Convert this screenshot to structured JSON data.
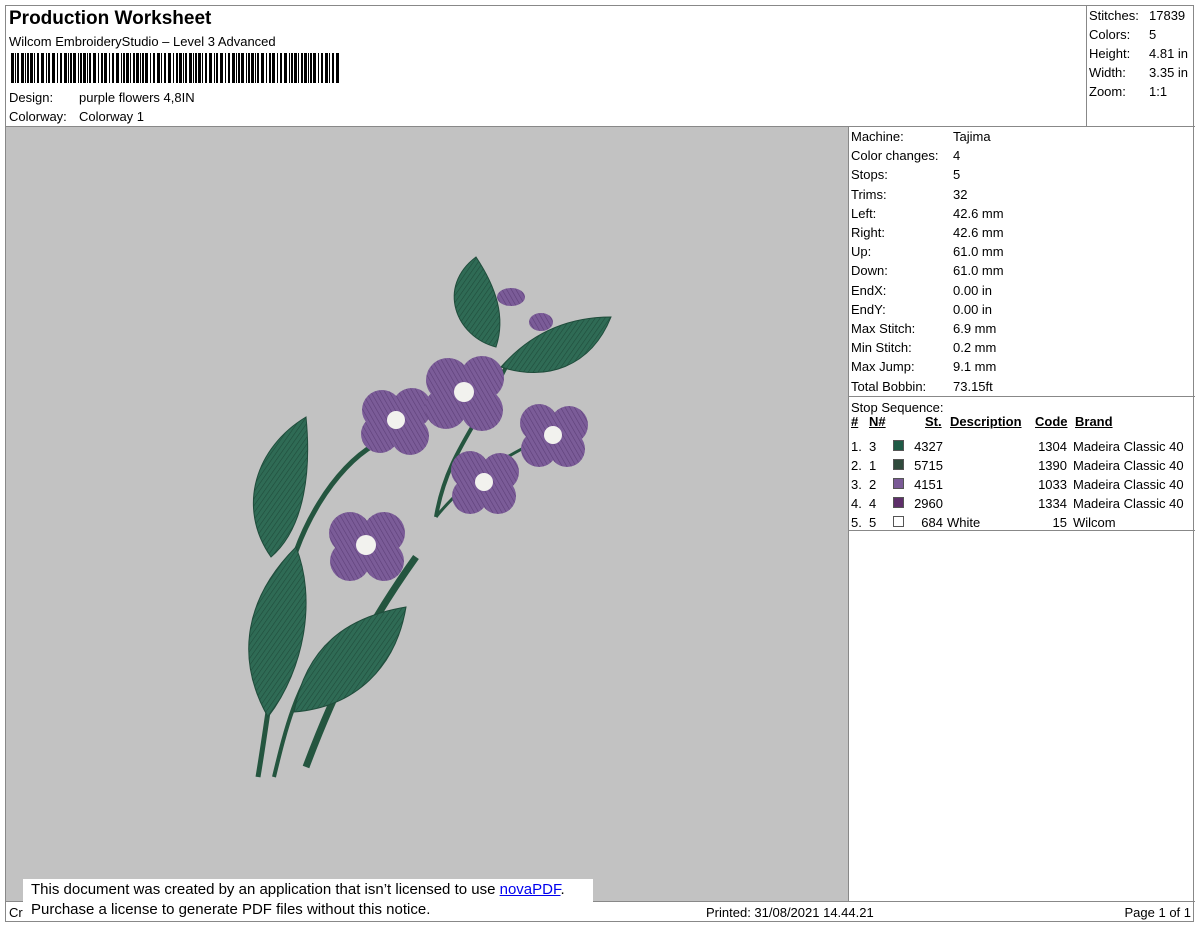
{
  "header": {
    "title": "Production Worksheet",
    "subtitle": "Wilcom EmbroideryStudio – Level 3 Advanced",
    "design_label": "Design:",
    "design_value": "purple flowers 4,8IN",
    "colorway_label": "Colorway:",
    "colorway_value": "Colorway 1"
  },
  "stats": [
    {
      "label": "Stitches:",
      "value": "17839"
    },
    {
      "label": "Colors:",
      "value": "5"
    },
    {
      "label": "Height:",
      "value": "4.81 in"
    },
    {
      "label": "Width:",
      "value": "3.35 in"
    },
    {
      "label": "Zoom:",
      "value": "1:1"
    }
  ],
  "machine_info": [
    {
      "label": "Machine:",
      "value": "Tajima"
    },
    {
      "label": "Color changes:",
      "value": "4"
    },
    {
      "label": "Stops:",
      "value": "5"
    },
    {
      "label": "Trims:",
      "value": "32"
    },
    {
      "label": "Left:",
      "value": "42.6 mm"
    },
    {
      "label": "Right:",
      "value": "42.6 mm"
    },
    {
      "label": "Up:",
      "value": "61.0 mm"
    },
    {
      "label": "Down:",
      "value": "61.0 mm"
    },
    {
      "label": "EndX:",
      "value": "0.00 in"
    },
    {
      "label": "EndY:",
      "value": "0.00 in"
    },
    {
      "label": "Max Stitch:",
      "value": "6.9 mm"
    },
    {
      "label": "Min Stitch:",
      "value": "0.2 mm"
    },
    {
      "label": "Max Jump:",
      "value": "9.1 mm"
    },
    {
      "label": "Total Bobbin:",
      "value": "73.15ft"
    }
  ],
  "stop_sequence": {
    "title": "Stop Sequence:",
    "columns": {
      "num": "#",
      "n": "N#",
      "st": "St.",
      "description": "Description",
      "code": "Code",
      "brand": "Brand"
    },
    "rows": [
      {
        "num": "1.",
        "n": "3",
        "color": "#1f5a45",
        "st": "4327",
        "description": "",
        "code": "1304",
        "brand": "Madeira Classic 40"
      },
      {
        "num": "2.",
        "n": "1",
        "color": "#2f4a3c",
        "st": "5715",
        "description": "",
        "code": "1390",
        "brand": "Madeira Classic 40"
      },
      {
        "num": "3.",
        "n": "2",
        "color": "#7a5a96",
        "st": "4151",
        "description": "",
        "code": "1033",
        "brand": "Madeira Classic 40"
      },
      {
        "num": "4.",
        "n": "4",
        "color": "#5e2f6a",
        "st": "2960",
        "description": "",
        "code": "1334",
        "brand": "Madeira Classic 40"
      },
      {
        "num": "5.",
        "n": "5",
        "color": "#ffffff",
        "st": "684",
        "description": "White",
        "code": "15",
        "brand": "Wilcom"
      }
    ]
  },
  "footer": {
    "left": "Cr",
    "printed": "Printed: 31/08/2021 14.44.21",
    "page": "Page 1 of 1"
  },
  "notice": {
    "line1": "This document was created by an application that isn’t licensed to use ",
    "link": "novaPDF",
    "line1_end": ".",
    "line2": "Purchase a license to generate PDF files without this notice."
  },
  "colors": {
    "leaf": "#2f6b55",
    "leaf_dark": "#1f4c3b",
    "petal": "#7b5c98",
    "petal_dark": "#5d3f78",
    "center": "#f2f2ee",
    "canvas": "#c2c2c2"
  }
}
